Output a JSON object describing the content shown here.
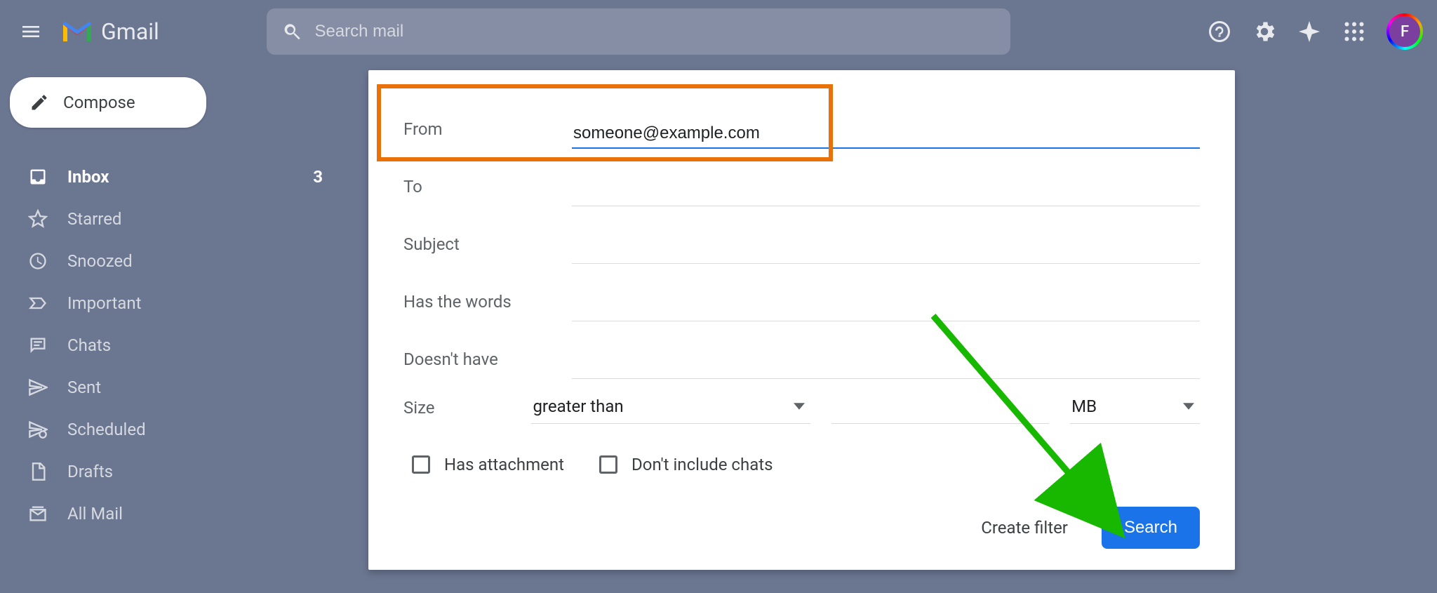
{
  "header": {
    "app_name": "Gmail",
    "search_placeholder": "Search mail",
    "avatar_letter": "F"
  },
  "compose_label": "Compose",
  "sidebar": {
    "items": [
      {
        "label": "Inbox",
        "active": true,
        "badge": "3",
        "icon": "inbox"
      },
      {
        "label": "Starred",
        "icon": "star"
      },
      {
        "label": "Snoozed",
        "icon": "clock"
      },
      {
        "label": "Important",
        "icon": "important"
      },
      {
        "label": "Chats",
        "icon": "chat"
      },
      {
        "label": "Sent",
        "icon": "sent"
      },
      {
        "label": "Scheduled",
        "icon": "scheduled"
      },
      {
        "label": "Drafts",
        "icon": "draft"
      },
      {
        "label": "All Mail",
        "icon": "allmail"
      }
    ]
  },
  "filter": {
    "from_label": "From",
    "from_value": "someone@example.com",
    "to_label": "To",
    "to_value": "",
    "subject_label": "Subject",
    "subject_value": "",
    "has_words_label": "Has the words",
    "has_words_value": "",
    "doesnt_have_label": "Doesn't have",
    "doesnt_have_value": "",
    "size_label": "Size",
    "size_operator": "greater than",
    "size_value": "",
    "size_unit": "MB",
    "has_attachment_label": "Has attachment",
    "dont_include_chats_label": "Don't include chats",
    "create_filter_label": "Create filter",
    "search_label": "Search"
  }
}
